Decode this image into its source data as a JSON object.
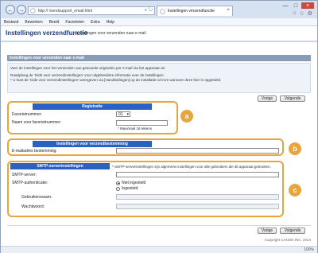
{
  "browser": {
    "url": "http://                /sendsupport_email.html",
    "tab_title": "Instellingen verzendfunctie",
    "icons": [
      "back-arrow-icon",
      "forward-arrow-icon",
      "home-icon",
      "star-icon",
      "gear-icon"
    ]
  },
  "menu": [
    "Bestand",
    "Bewerken",
    "Beeld",
    "Favorieten",
    "Extra",
    "Help"
  ],
  "header": {
    "title": "Instellingen verzendfunctie",
    "subtitle": "Instellingen voor verzenden naar e-mail"
  },
  "buttons": {
    "prev": "Vorige",
    "next": "Volgende"
  },
  "info": {
    "heading": "Instellingen voor verzenden naar e-mail",
    "line1": "Voer de instellingen voor het verzenden van gescande originelen per e-mail via het apparaat uit.",
    "line2": "Raadpleeg de 'Gids voor verzendinstellingen' voor uitgebreidere informatie over de instellingen.",
    "line3": "* U kunt de 'Gids voor verzendinstellingen' weergeven via [Handleidingen] op de installatie-cd-rom wanneer deze hier is opgesteld."
  },
  "registratie": {
    "title": "Registratie",
    "favoriet_label": "Favorietnummer:",
    "favoriet_value": "01",
    "naam_label": "Naam voor favorietnummer:",
    "naam_value": "",
    "naam_hint": "* Maximaal 16 tekens"
  },
  "verzend": {
    "title": "Instellingen voor verzendbestemming",
    "email_label": "E-mailadres bestemming:",
    "email_value": ""
  },
  "smtp": {
    "title": "SMTP-serverinstellingen",
    "note": "* SMTP-serverinstellingen zijn algemene instellingen voor alle gebruikers die dit apparaat gebruiken.",
    "server_label": "SMTP-server:",
    "server_value": "",
    "auth_label": "SMTP-authenticatie:",
    "auth_options": [
      "Niet ingesteld",
      "Ingesteld"
    ],
    "auth_selected": "Niet ingesteld",
    "user_label": "Gebruikersnaam:",
    "pass_label": "Wachtwoord:"
  },
  "callouts": [
    "a",
    "b",
    "c"
  ],
  "footer": {
    "copyright": "Copyright CANON INC. 2014"
  },
  "status": {
    "zoom": "100%"
  },
  "colors": {
    "highlight": "#e6a53d",
    "group_title": "#2a62c4",
    "section_head": "#8a9bb6"
  }
}
